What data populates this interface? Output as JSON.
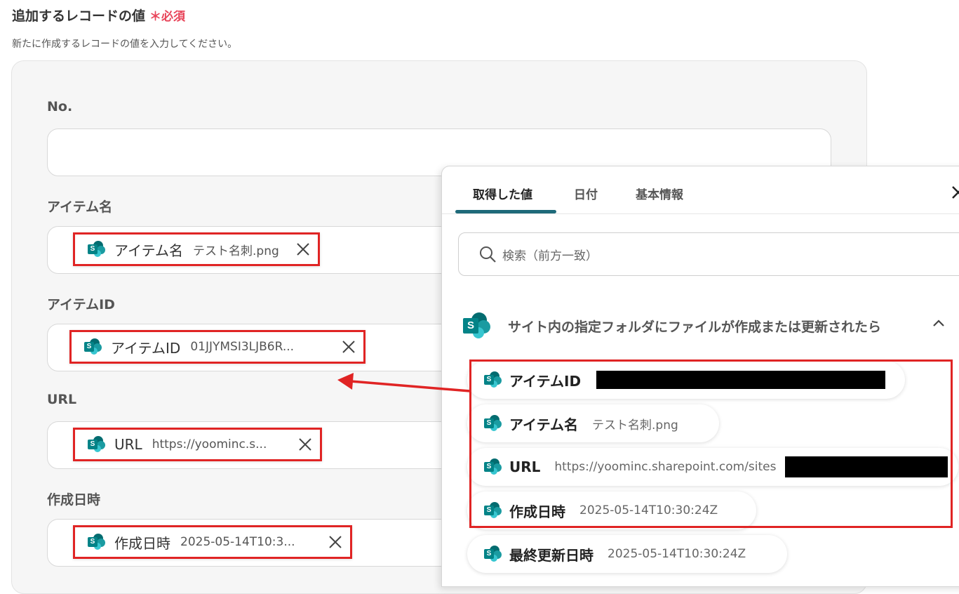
{
  "header": {
    "title": "追加するレコードの値",
    "required": "＊必須",
    "description": "新たに作成するレコードの値を入力してください。"
  },
  "form": {
    "fields": [
      {
        "label": "No.",
        "chip": null
      },
      {
        "label": "アイテム名",
        "chip": {
          "name": "アイテム名",
          "value": "テスト名刺.png"
        }
      },
      {
        "label": "アイテムID",
        "chip": {
          "name": "アイテムID",
          "value": "01JJYMSI3LJB6R..."
        }
      },
      {
        "label": "URL",
        "chip": {
          "name": "URL",
          "value": "https://yoominc.s..."
        }
      },
      {
        "label": "作成日時",
        "chip": {
          "name": "作成日時",
          "value": "2025-05-14T10:3..."
        }
      }
    ]
  },
  "panel": {
    "tabs": [
      "取得した値",
      "日付",
      "基本情報"
    ],
    "active_tab": 0,
    "search_placeholder": "検索（前方一致）",
    "group_title": "サイト内の指定フォルダにファイルが作成または更新されたら",
    "items": [
      {
        "name": "アイテムID",
        "value": ""
      },
      {
        "name": "アイテム名",
        "value": "テスト名刺.png"
      },
      {
        "name": "URL",
        "value": "https://yoominc.sharepoint.com/sites"
      },
      {
        "name": "作成日時",
        "value": "2025-05-14T10:30:24Z"
      },
      {
        "name": "最終更新日時",
        "value": "2025-05-14T10:30:24Z"
      }
    ]
  },
  "colors": {
    "highlight": "#e02424",
    "accent": "#1e6a7a",
    "required": "#e8455a"
  },
  "icons": {
    "chip_icon": "sharepoint-icon",
    "close": "close-icon",
    "search": "search-icon",
    "collapse": "chevron-up-icon"
  }
}
